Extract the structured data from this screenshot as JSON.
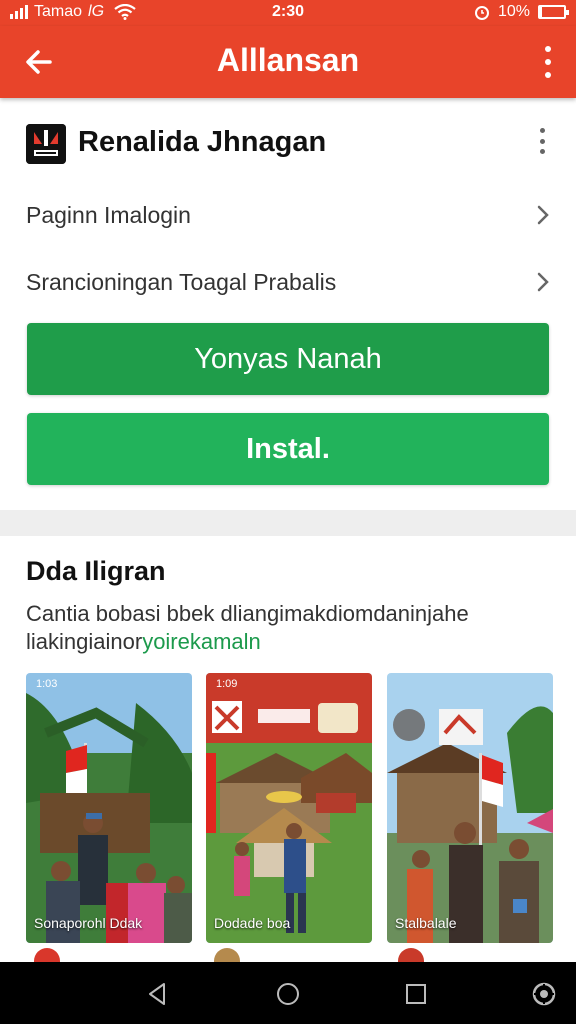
{
  "status_bar": {
    "carrier": "Tamao",
    "network": "lG",
    "time": "2:30",
    "battery_percent": "10%",
    "battery_level": 0.1
  },
  "app_bar": {
    "title": "Alllansan",
    "back_icon": "arrow-left-icon",
    "menu_icon": "more-vert-icon"
  },
  "app": {
    "name": "Renalida Jhnagan",
    "logo_icon": "app-logo-icon"
  },
  "list": [
    {
      "label": "Paginn Imalogin"
    },
    {
      "label": "Srancioningan Toagal Prabalis"
    }
  ],
  "buttons": {
    "primary": "Yonyas Nanah",
    "install": "Instal."
  },
  "section": {
    "title": "Dda Iligran",
    "description": "Cantia bobasi bbek dliangimakdiomdaninjahe",
    "description_line2": "liakingiainor",
    "description_link": "yoirekamaln"
  },
  "screenshots": [
    {
      "time": "1:03",
      "caption": "Sonaporohl Ddak"
    },
    {
      "time": "1:09",
      "caption": "Dodade boa"
    },
    {
      "time": "",
      "caption": "Stalbalale"
    }
  ],
  "colors": {
    "accent": "#e8442a",
    "primary_button": "#1f9d4a",
    "install_button": "#22b35b",
    "link": "#1c9a4c"
  },
  "nav_bar": {
    "back_icon": "nav-back-icon",
    "home_icon": "nav-home-icon",
    "recents_icon": "nav-recents-icon",
    "assistant_icon": "assistant-icon"
  }
}
